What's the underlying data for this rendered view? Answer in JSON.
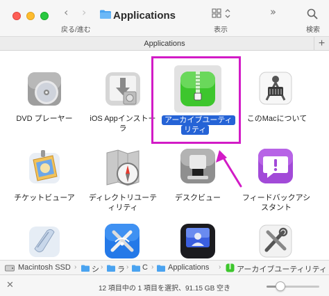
{
  "toolbar": {
    "nav_label": "戻る/進む",
    "title": "Applications",
    "view_label": "表示",
    "search_label": "検索"
  },
  "tabbar": {
    "title": "Applications",
    "add": "+"
  },
  "apps": [
    {
      "label": "DVD プレーヤー",
      "icon": "dvd-player-icon"
    },
    {
      "label": "iOS Appインストー",
      "label2": "ラ",
      "icon": "ios-app-installer-icon"
    },
    {
      "label": "アーカイブユーティ",
      "label2": "リティ",
      "icon": "archive-utility-icon",
      "selected": true
    },
    {
      "label": "このMacについて",
      "icon": "about-this-mac-icon"
    },
    {
      "label": "チケットビューア",
      "icon": "ticket-viewer-icon"
    },
    {
      "label": "ディレクトリユーテ",
      "label2": "ィリティ",
      "icon": "directory-utility-icon"
    },
    {
      "label": "デスクビュー",
      "icon": "desk-view-icon"
    },
    {
      "label": "フィードバックアシ",
      "label2": "スタント",
      "icon": "feedback-assistant-icon"
    },
    {
      "label": "",
      "icon": "script-icon"
    },
    {
      "label": "",
      "icon": "wireless-diagnostics-icon"
    },
    {
      "label": "",
      "icon": "screen-sharing-icon"
    },
    {
      "label": "",
      "icon": "system-tool-icon"
    }
  ],
  "pathbar": {
    "items": [
      "Macintosh SSD",
      "シ",
      "ラ",
      "C",
      "Applications",
      "アーカイブユーティリティ"
    ],
    "separator": "›"
  },
  "status": {
    "close": "✕",
    "text": "12 項目中の 1 項目を選択、91.15 GB 空き",
    "icon_size_level": 0.26
  },
  "colors": {
    "selection": "#2563d6",
    "callout": "#d21bc6"
  }
}
